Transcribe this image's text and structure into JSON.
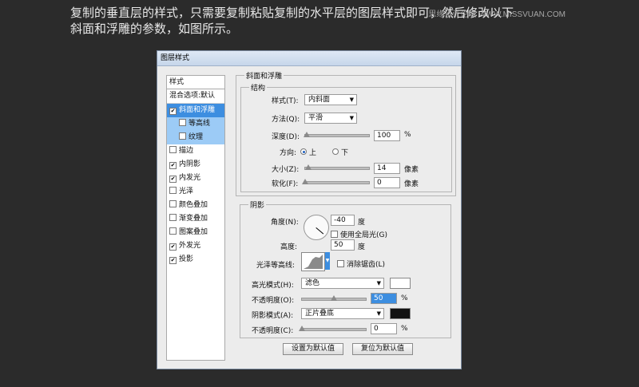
{
  "caption": {
    "line1": "复制的垂直层的样式，只需要复制粘贴复制的水平层的图层样式即可，然后修改以下",
    "line2": "斜面和浮雕的参数，如图所示。",
    "watermark": "思缘设计论坛 WWW.MISSVUAN.COM"
  },
  "dialog": {
    "title": "图层样式"
  },
  "left_panel": {
    "header": "样式",
    "blend": "混合选项:默认",
    "items": [
      {
        "label": "斜面和浮雕",
        "checked": "✔"
      },
      {
        "label": "等高线",
        "checked": ""
      },
      {
        "label": "纹理",
        "checked": ""
      },
      {
        "label": "描边",
        "checked": ""
      },
      {
        "label": "内阴影",
        "checked": "✔"
      },
      {
        "label": "内发光",
        "checked": "✔"
      },
      {
        "label": "光泽",
        "checked": ""
      },
      {
        "label": "颜色叠加",
        "checked": ""
      },
      {
        "label": "渐变叠加",
        "checked": ""
      },
      {
        "label": "图案叠加",
        "checked": ""
      },
      {
        "label": "外发光",
        "checked": "✔"
      },
      {
        "label": "投影",
        "checked": "✔"
      }
    ]
  },
  "bevel": {
    "section_title": "斜面和浮雕",
    "structure_title": "结构",
    "style_label": "样式(T):",
    "style_value": "内斜面",
    "technique_label": "方法(Q):",
    "technique_value": "平滑",
    "depth_label": "深度(D):",
    "depth_value": "100",
    "depth_unit": "%",
    "depth_level": 0.02,
    "direction_label": "方向:",
    "direction_up": "上",
    "direction_down": "下",
    "size_label": "大小(Z):",
    "size_value": "14",
    "size_unit": "像素",
    "size_level": 0.05,
    "soften_label": "软化(F):",
    "soften_value": "0",
    "soften_unit": "像素",
    "soften_level": 0.0
  },
  "shading": {
    "title": "阴影",
    "angle_label": "角度(N):",
    "angle_value": "-40",
    "angle_unit": "度",
    "global_light_label": "使用全局光(G)",
    "altitude_label": "高度:",
    "altitude_value": "50",
    "altitude_unit": "度",
    "gloss_label": "光泽等高线:",
    "antialias_label": "消除锯齿(L)",
    "highlight_label": "高光模式(H):",
    "highlight_value": "滤色",
    "highlight_color": "#ffffff",
    "opacity1_label": "不透明度(O):",
    "opacity1_value": "50",
    "opacity1_level": 0.5,
    "shadow_label": "阴影模式(A):",
    "shadow_value": "正片叠底",
    "shadow_color": "#111111",
    "opacity2_label": "不透明度(C):",
    "opacity2_value": "0",
    "opacity2_level": 0.0,
    "percent": "%"
  },
  "buttons": {
    "make_default": "设置为默认值",
    "reset_default": "复位为默认值"
  }
}
